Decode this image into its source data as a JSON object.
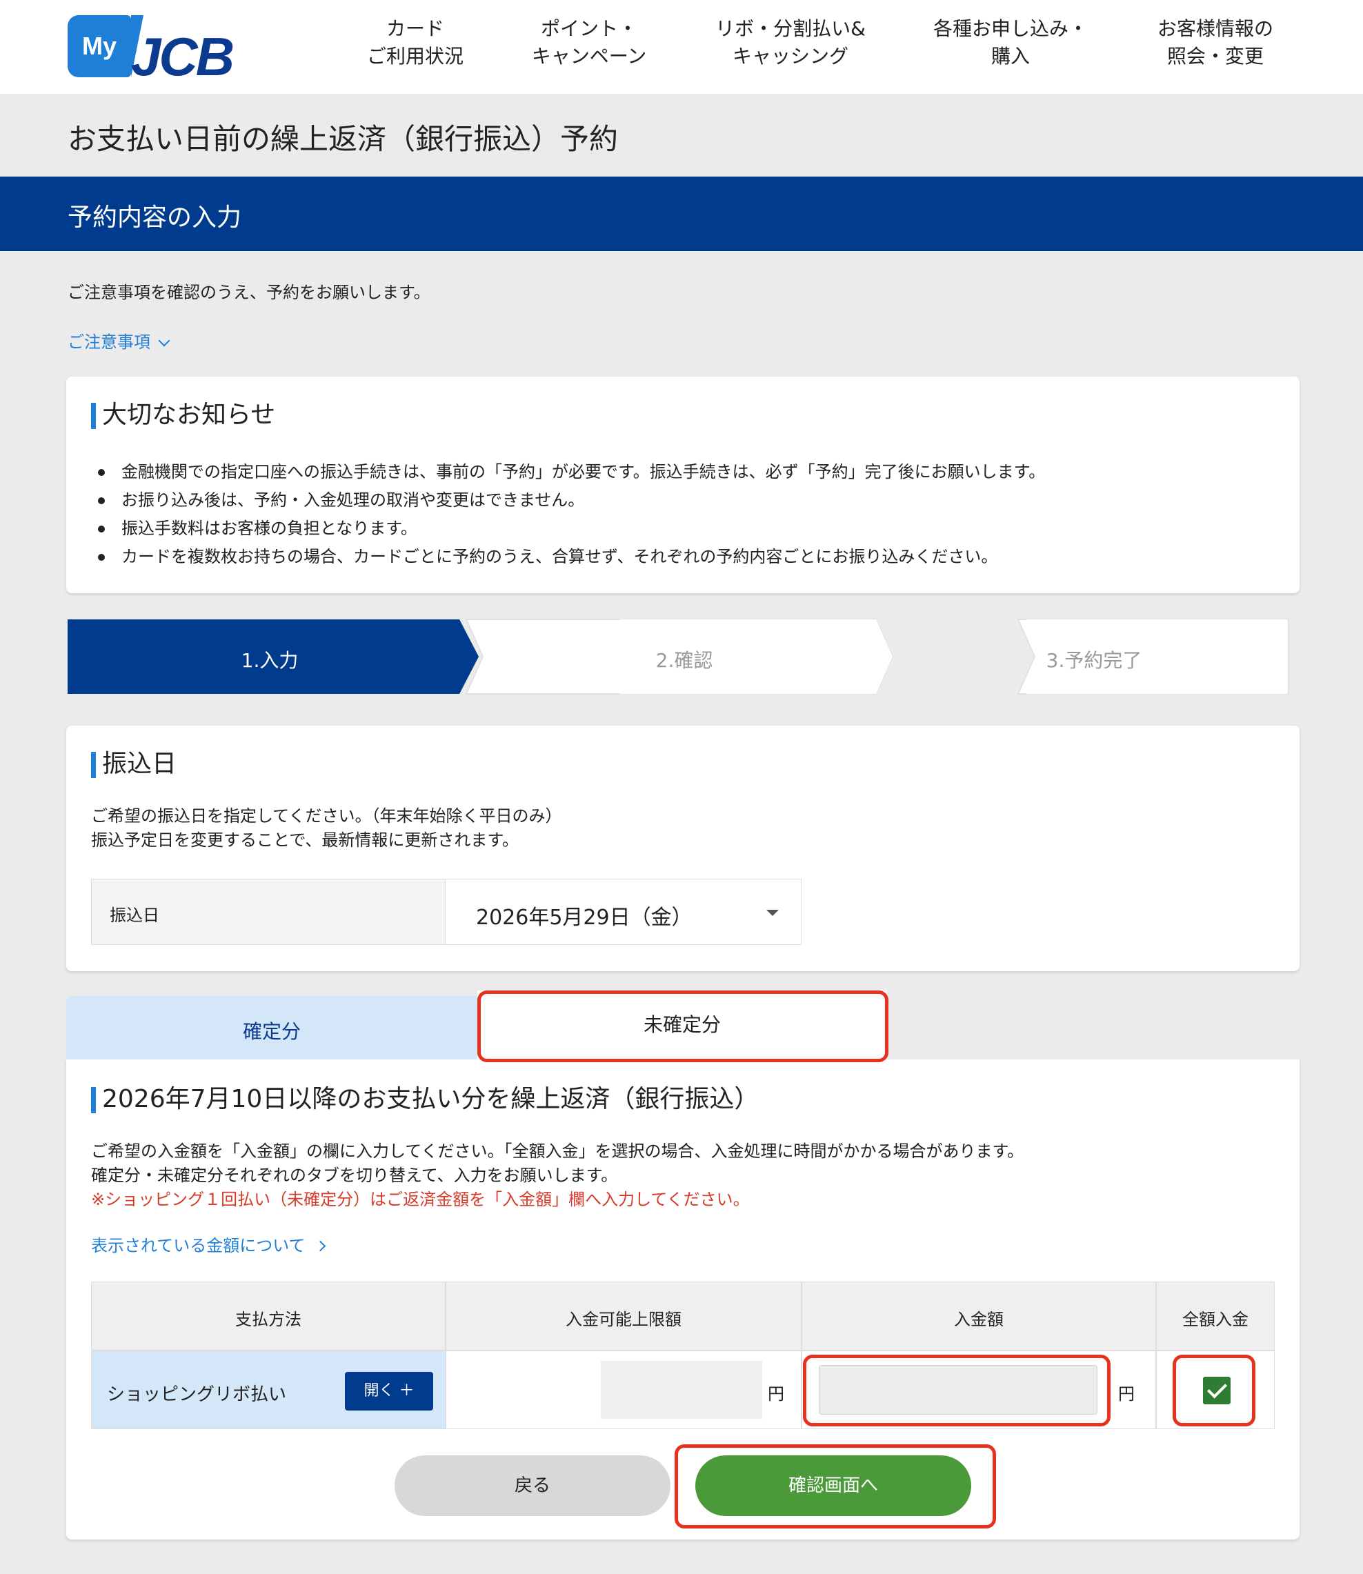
{
  "brand": {
    "my": "My",
    "jcb": "JCB"
  },
  "nav": [
    "カード\nご利用状況",
    "ポイント・\nキャンペーン",
    "リボ・分割払い&\nキャッシング",
    "各種お申し込み・\n購入",
    "お客様情報の\n照会・変更"
  ],
  "page_title": "お支払い日前の繰上返済（銀行振込）予約",
  "section_title": "予約内容の入力",
  "intro": "ご注意事項を確認のうえ、予約をお願いします。",
  "caution_link": "ご注意事項",
  "notice": {
    "title": "大切なお知らせ",
    "items": [
      "金融機関での指定口座への振込手続きは、事前の「予約」が必要です。振込手続きは、必ず「予約」完了後にお願いします。",
      "お振り込み後は、予約・入金処理の取消や変更はできません。",
      "振込手数料はお客様の負担となります。",
      "カードを複数枚お持ちの場合、カードごとに予約のうえ、合算せず、それぞれの予約内容ごとにお振り込みください。"
    ]
  },
  "steps": [
    "1.入力",
    "2.確認",
    "3.予約完了"
  ],
  "transfer_date": {
    "title": "振込日",
    "desc1": "ご希望の振込日を指定してください。（年末年始除く平日のみ）",
    "desc2": "振込予定日を変更することで、最新情報に更新されます。",
    "label": "振込日",
    "value": "2026年5月29日（金）"
  },
  "tabs": {
    "confirmed": "確定分",
    "unconfirmed": "未確定分"
  },
  "repayment": {
    "title": "2026年7月10日以降のお支払い分を繰上返済（銀行振込）",
    "desc1": "ご希望の入金額を「入金額」の欄に入力してください。「全額入金」を選択の場合、入金処理に時間がかかる場合があります。",
    "desc2": "確定分・未確定分それぞれのタブを切り替えて、入力をお願いします。",
    "note": "※ショッピング１回払い（未確定分）はご返済金額を「入金額」欄へ入力してください。",
    "amount_link": "表示されている金額について"
  },
  "table": {
    "headers": [
      "支払方法",
      "入金可能上限額",
      "入金額",
      "全額入金"
    ],
    "row": {
      "method": "ショッピングリボ払い",
      "open_label": "開く ＋",
      "limit": "",
      "yen1": "円",
      "amount": "",
      "yen2": "円",
      "full_payment_checked": true
    }
  },
  "buttons": {
    "back": "戻る",
    "next": "確認画面へ"
  },
  "colors": {
    "navy": "#003b8e",
    "accent_blue": "#1f7fd6",
    "green": "#4a9a3a",
    "highlight_red": "#e8321f"
  }
}
